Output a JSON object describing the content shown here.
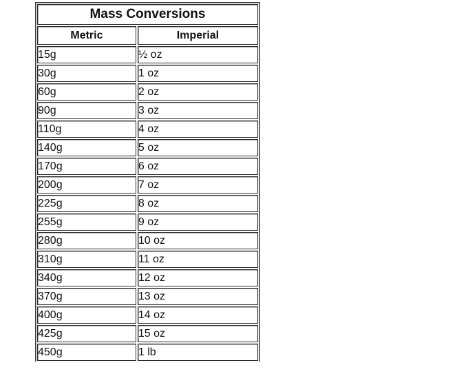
{
  "table": {
    "title": "Mass Conversions",
    "headers": [
      "Metric",
      "Imperial"
    ],
    "rows": [
      [
        "15g",
        "½ oz"
      ],
      [
        "30g",
        "1 oz"
      ],
      [
        "60g",
        "2 oz"
      ],
      [
        "90g",
        "3 oz"
      ],
      [
        "110g",
        "4 oz"
      ],
      [
        "140g",
        "5 oz"
      ],
      [
        "170g",
        "6 oz"
      ],
      [
        "200g",
        "7 oz"
      ],
      [
        "225g",
        "8 oz"
      ],
      [
        "255g",
        "9 oz"
      ],
      [
        "280g",
        "10 oz"
      ],
      [
        "310g",
        "11 oz"
      ],
      [
        "340g",
        "12 oz"
      ],
      [
        "370g",
        "13 oz"
      ],
      [
        "400g",
        "14 oz"
      ],
      [
        "425g",
        "15 oz"
      ],
      [
        "450g",
        "1 lb"
      ]
    ]
  }
}
